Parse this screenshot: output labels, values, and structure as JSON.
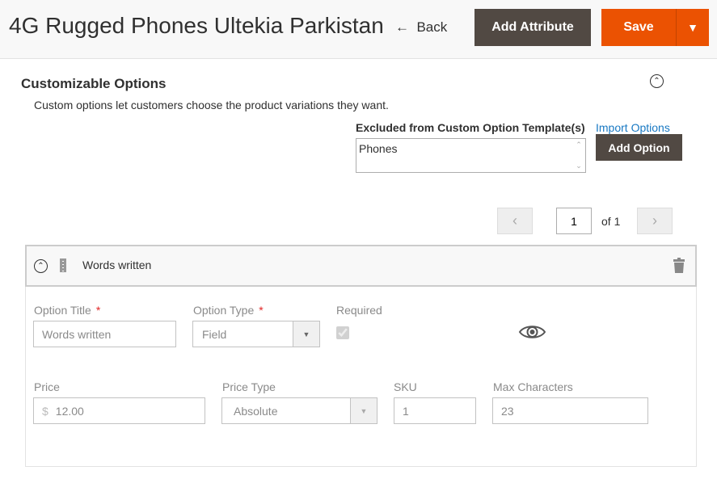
{
  "header": {
    "title": "4G Rugged Phones Ultekia Parkistan",
    "back_label": "Back",
    "add_attribute_label": "Add Attribute",
    "save_label": "Save"
  },
  "section": {
    "title": "Customizable Options",
    "description": "Custom options let customers choose the product variations they want.",
    "excluded_label": "Excluded from Custom Option Template(s)",
    "excluded_value": "Phones",
    "import_label": "Import Options",
    "add_option_label": "Add Option"
  },
  "pager": {
    "current": "1",
    "of_label": "of 1"
  },
  "option": {
    "name": "Words written",
    "title_label": "Option Title",
    "title_value": "Words written",
    "type_label": "Option Type",
    "type_value": "Field",
    "required_label": "Required",
    "required_checked": true,
    "price_label": "Price",
    "currency": "$",
    "price_value": "12.00",
    "price_type_label": "Price Type",
    "price_type_value": "Absolute",
    "sku_label": "SKU",
    "sku_value": "1",
    "max_label": "Max Characters",
    "max_value": "23"
  },
  "icons": {
    "back": "arrow-left-icon",
    "dropdown": "caret-down-icon",
    "collapse": "chevron-up-circle-icon",
    "drag": "drag-handle-icon",
    "delete": "trash-icon",
    "preview": "eye-icon"
  },
  "colors": {
    "primary": "#eb5202",
    "dark_button": "#514943",
    "link": "#1979c3",
    "required_star": "#e22626"
  }
}
